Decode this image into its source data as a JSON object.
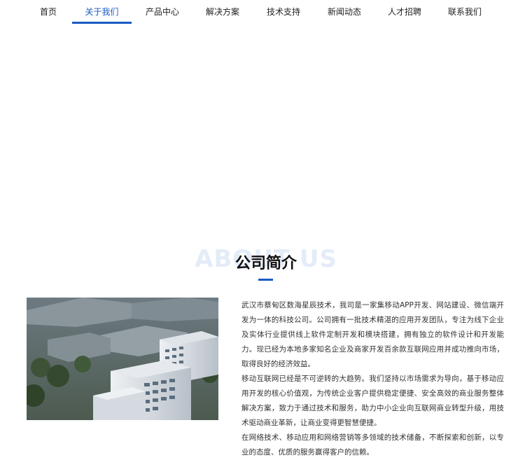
{
  "nav": {
    "items": [
      {
        "label": "首页"
      },
      {
        "label": "关于我们",
        "active": true
      },
      {
        "label": "产品中心"
      },
      {
        "label": "解决方案"
      },
      {
        "label": "技术支持"
      },
      {
        "label": "新闻动态"
      },
      {
        "label": "人才招聘"
      },
      {
        "label": "联系我们"
      }
    ]
  },
  "about": {
    "watermark": "ABOUT US",
    "title": "公司简介",
    "paragraphs": [
      "武汉市蔡甸区数海星辰技术，我司是一家集移动APP开发、网站建设、微信端开发为一体的科技公司。公司拥有一批技术精湛的应用开发团队，专注为线下企业及实体行业提供线上软件定制开发和模块搭建，拥有独立的软件设计和开发能力。现已经为本地多家知名企业及商家开发百余款互联网应用并成功推向市场，取得良好的经济效益。",
      "移动互联网已经是不可逆转的大趋势。我们坚持以市场需求为导向，基于移动应用开发的核心价值观，为传统企业客户提供稳定便捷、安全高效的商业服务整体解决方案，致力于通过技术和服务，助力中小企业向互联网商业转型升级，用技术驱动商业革新，让商业变得更智慧便捷。",
      "在网络技术、移动应用和网络营销等多领域的技术储备，不断探索和创新，以专业的态度、优质的服务赢得客户的信赖。"
    ]
  },
  "colors": {
    "accent": "#1a5bc4",
    "watermark": "#e4ecf8"
  },
  "icons": {
    "photo": "building-aerial-photo"
  }
}
